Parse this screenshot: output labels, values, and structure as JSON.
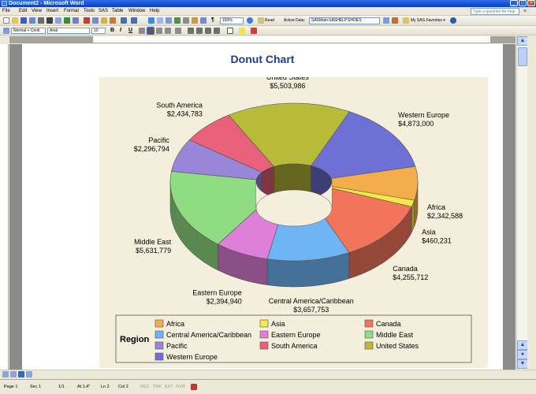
{
  "window": {
    "title": "Document2 - Microsoft Word",
    "controls": [
      "_",
      "□",
      "×"
    ]
  },
  "menubar": {
    "items": [
      "File",
      "Edit",
      "View",
      "Insert",
      "Format",
      "Tools",
      "SAS",
      "Table",
      "Window",
      "Help"
    ],
    "help_placeholder": "Type a question for help",
    "close_doc": "×"
  },
  "toolbar": {
    "zoom": "150%",
    "read_label": "Read",
    "active_data_label": "Active Data:",
    "active_data_value": "SASMain:SASHELP.SHOES",
    "favorites_label": "My SAS Favorites ▾",
    "style_value": "Normal + Centi",
    "font_value": "Arial",
    "size_value": "10",
    "bold": "B",
    "italic": "I",
    "underline": "U",
    "pilcrow": "¶"
  },
  "document": {
    "chart_title": "Donut Chart"
  },
  "chart_data": {
    "type": "pie",
    "title": "Donut Chart",
    "legend_title": "Region",
    "legend_position": "bottom",
    "currency_prefix": "$",
    "slices": [
      {
        "name": "Africa",
        "value": 2342588,
        "label": "$2,342,588",
        "color": "#f3ad4b"
      },
      {
        "name": "Asia",
        "value": 460231,
        "label": "$460,231",
        "color": "#f6e847"
      },
      {
        "name": "Canada",
        "value": 4255712,
        "label": "$4,255,712",
        "color": "#f2745a"
      },
      {
        "name": "Central America/Caribbean",
        "value": 3657753,
        "label": "$3,657,753",
        "color": "#6fb4f4"
      },
      {
        "name": "Eastern Europe",
        "value": 2394940,
        "label": "$2,394,940",
        "color": "#df80d8"
      },
      {
        "name": "Middle East",
        "value": 5631779,
        "label": "$5,631,779",
        "color": "#8fdc82"
      },
      {
        "name": "Pacific",
        "value": 2296794,
        "label": "$2,296,794",
        "color": "#9a86d8"
      },
      {
        "name": "South America",
        "value": 2434783,
        "label": "$2,434,783",
        "color": "#e8607a"
      },
      {
        "name": "United States",
        "value": 5503986,
        "label": "$5,503,986",
        "color": "#b8bb3a"
      },
      {
        "name": "Western Europe",
        "value": 4873000,
        "label": "$4,873,000",
        "color": "#6f70d6"
      }
    ]
  },
  "statusbar": {
    "page": "Page 1",
    "sec": "Sec 1",
    "pages": "1/1",
    "at": "At 1.4\"",
    "ln": "Ln 2",
    "col": "Col 2",
    "rec": "REC",
    "trk": "TRK",
    "ext": "EXT",
    "ovr": "OVR"
  }
}
